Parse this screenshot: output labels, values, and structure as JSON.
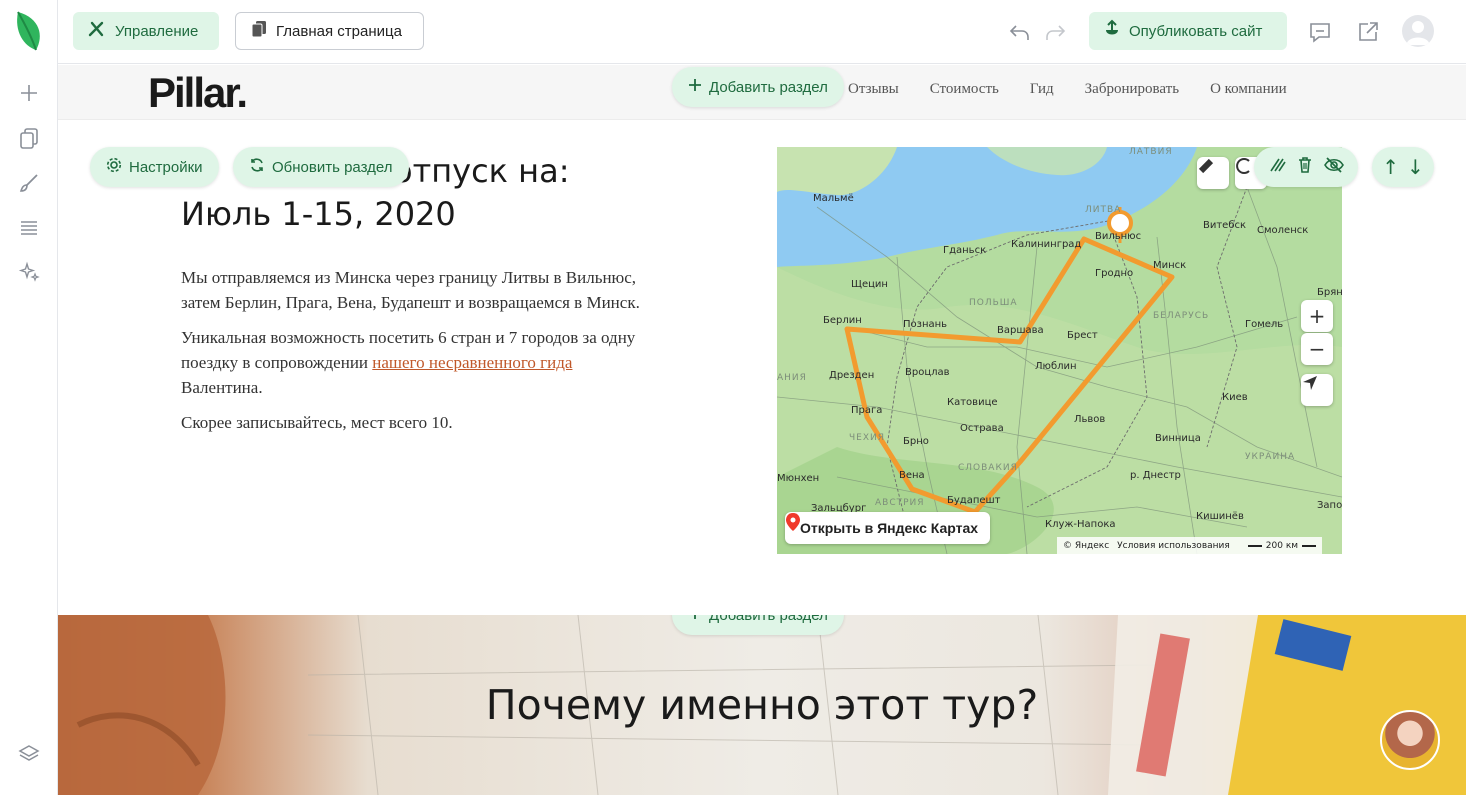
{
  "toolbar": {
    "manage_label": "Управление",
    "home_label": "Главная страница",
    "publish_label": "Опубликовать сайт"
  },
  "site": {
    "brand": "Pillar.",
    "nav": [
      "Отзывы",
      "Стоимость",
      "Гид",
      "Забронировать",
      "О компании"
    ],
    "add_section_label": "Добавить раздел",
    "settings_label": "Настройки",
    "refresh_label": "Обновить раздел",
    "headline_line1_partial": "отпуск на:",
    "headline_line2": "Июль 1-15, 2020",
    "p1": "Мы отправляемся из Минска через границу Литвы в Вильнюс, затем Берлин, Прага, Вена, Будапешт и возвращаемся в Минск.",
    "p2_before": "Уникальная возможность посетить 6 стран и 7 городов за одну поездку в сопровождении ",
    "p2_link": "нашего несравненного гида ",
    "p2_after": "Валентина.",
    "p3": "Скорее записывайтесь, мест всего 10."
  },
  "map": {
    "open_label": "Открыть в Яндекс Картах",
    "copyright": "© Яндекс",
    "terms": "Условия использования",
    "scale": "200 км",
    "labels": [
      {
        "t": "ЛАТВИЯ",
        "cap": true
      },
      {
        "t": "ЛИТВА",
        "cap": true
      },
      {
        "t": "Мальмё"
      },
      {
        "t": "Гданьск"
      },
      {
        "t": "Калининград"
      },
      {
        "t": "Вильнюс"
      },
      {
        "t": "Витебск"
      },
      {
        "t": "Смоленск"
      },
      {
        "t": "Гродно"
      },
      {
        "t": "Минск"
      },
      {
        "t": "Брянс"
      },
      {
        "t": "Щецин"
      },
      {
        "t": "ПОЛЬША",
        "cap": true
      },
      {
        "t": "Берлин"
      },
      {
        "t": "Познань"
      },
      {
        "t": "Варшава"
      },
      {
        "t": "Брест"
      },
      {
        "t": "БЕЛАРУСЬ",
        "cap": true
      },
      {
        "t": "Гомель"
      },
      {
        "t": "АНИЯ",
        "cap": true
      },
      {
        "t": "Дрезден"
      },
      {
        "t": "Вроцлав"
      },
      {
        "t": "Люблин"
      },
      {
        "t": "Прага"
      },
      {
        "t": "Катовице"
      },
      {
        "t": "Киев"
      },
      {
        "t": "ЧЕХИЯ",
        "cap": true
      },
      {
        "t": "Острава"
      },
      {
        "t": "Брно"
      },
      {
        "t": "Львов"
      },
      {
        "t": "Винница"
      },
      {
        "t": "СЛОВАКИЯ",
        "cap": true
      },
      {
        "t": "УКРАИНА",
        "cap": true
      },
      {
        "t": "Мюнхен"
      },
      {
        "t": "Вена"
      },
      {
        "t": "р. Днестр"
      },
      {
        "t": "АВСТРИЯ",
        "cap": true
      },
      {
        "t": "Будапешт"
      },
      {
        "t": "Зальцбург"
      },
      {
        "t": "Клуж-Напока"
      },
      {
        "t": "Кишинёв"
      },
      {
        "t": "Запо"
      }
    ]
  },
  "banner": {
    "title": "Почему именно этот тур?"
  }
}
